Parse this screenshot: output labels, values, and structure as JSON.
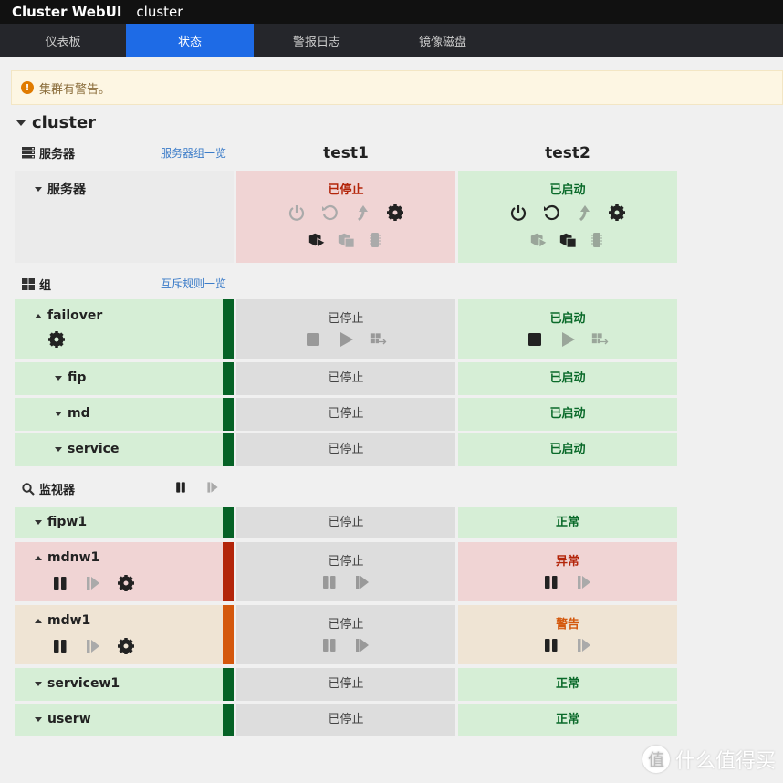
{
  "app": {
    "title": "Cluster WebUI",
    "cluster_name": "cluster"
  },
  "nav": {
    "tabs": [
      {
        "label": "仪表板",
        "active": false
      },
      {
        "label": "状态",
        "active": true
      },
      {
        "label": "警报日志",
        "active": false
      },
      {
        "label": "镜像磁盘",
        "active": false
      }
    ]
  },
  "alert": {
    "icon": "exclamation-icon",
    "text": "集群有警告。"
  },
  "cluster": {
    "name": "cluster"
  },
  "nodes": [
    "test1",
    "test2"
  ],
  "servers": {
    "section_label": "服务器",
    "link": "服务器组一览",
    "row_label": "服务器",
    "states": [
      {
        "status": "已停止",
        "tone": "red"
      },
      {
        "status": "已启动",
        "tone": "green"
      }
    ]
  },
  "groups": {
    "section_label": "组",
    "link": "互斥规则一览",
    "rows": [
      {
        "name": "failover",
        "states": [
          "已停止",
          "已启动"
        ]
      },
      {
        "name": "fip",
        "states": [
          "已停止",
          "已启动"
        ]
      },
      {
        "name": "md",
        "states": [
          "已停止",
          "已启动"
        ]
      },
      {
        "name": "service",
        "states": [
          "已停止",
          "已启动"
        ]
      }
    ]
  },
  "monitors": {
    "section_label": "监视器",
    "rows": [
      {
        "name": "fipw1",
        "states": [
          "已停止",
          "正常"
        ],
        "level": "green"
      },
      {
        "name": "mdnw1",
        "states": [
          "已停止",
          "异常"
        ],
        "level": "red"
      },
      {
        "name": "mdw1",
        "states": [
          "已停止",
          "警告"
        ],
        "level": "orange"
      },
      {
        "name": "servicew1",
        "states": [
          "已停止",
          "正常"
        ],
        "level": "green"
      },
      {
        "name": "userw",
        "states": [
          "已停止",
          "正常"
        ],
        "level": "green"
      }
    ]
  },
  "watermark": {
    "circle": "值",
    "text": "什么值得买"
  },
  "colors": {
    "accent": "#1e6be6",
    "ok": "#066226",
    "error": "#b3250a",
    "warning": "#d4580d"
  }
}
